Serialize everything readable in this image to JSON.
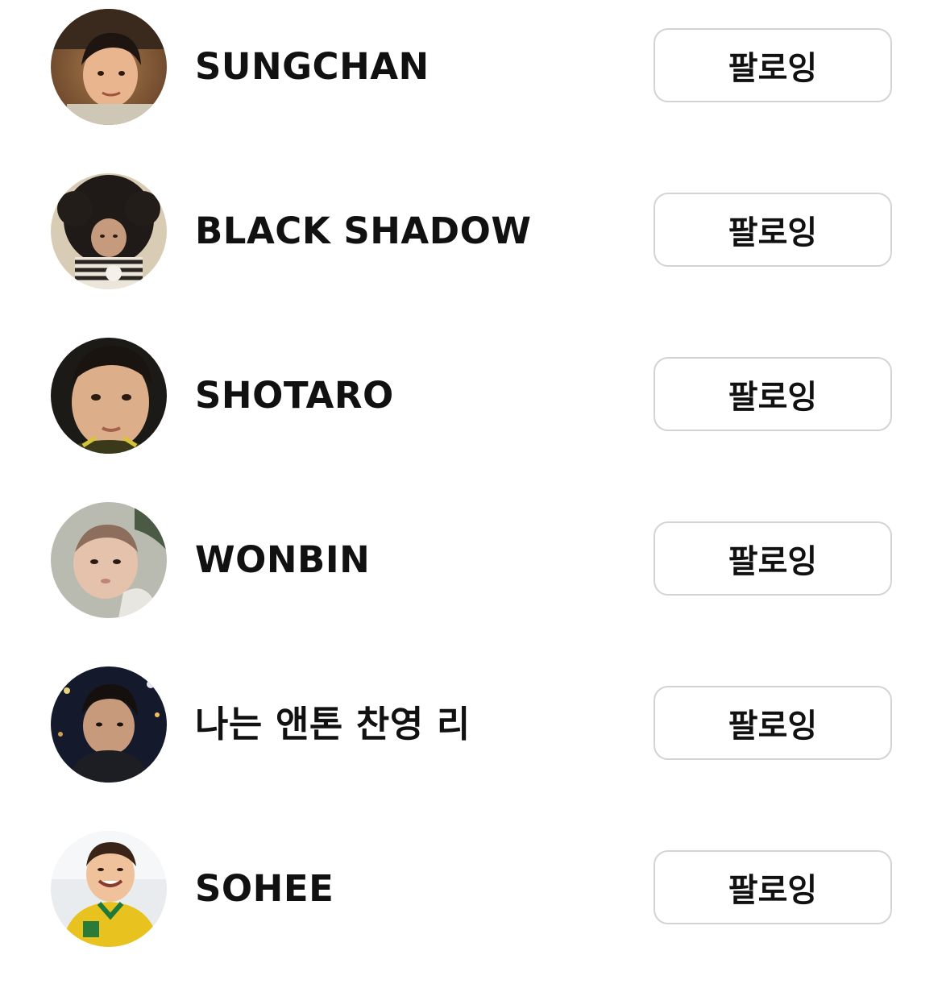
{
  "users": [
    {
      "name": "SUNGCHAN",
      "button_label": "팔로잉",
      "avatar_icon": "user-avatar-photo"
    },
    {
      "name": "BLACK SHADOW",
      "button_label": "팔로잉",
      "avatar_icon": "user-avatar-photo"
    },
    {
      "name": "SHOTARO",
      "button_label": "팔로잉",
      "avatar_icon": "user-avatar-photo"
    },
    {
      "name": "WONBIN",
      "button_label": "팔로잉",
      "avatar_icon": "user-avatar-photo"
    },
    {
      "name": "나는 앤톤 찬영 리",
      "button_label": "팔로잉",
      "avatar_icon": "user-avatar-photo"
    },
    {
      "name": "SOHEE",
      "button_label": "팔로잉",
      "avatar_icon": "user-avatar-photo"
    }
  ],
  "colors": {
    "button_border": "#d3d3d3",
    "text": "#111111",
    "background": "#ffffff"
  }
}
